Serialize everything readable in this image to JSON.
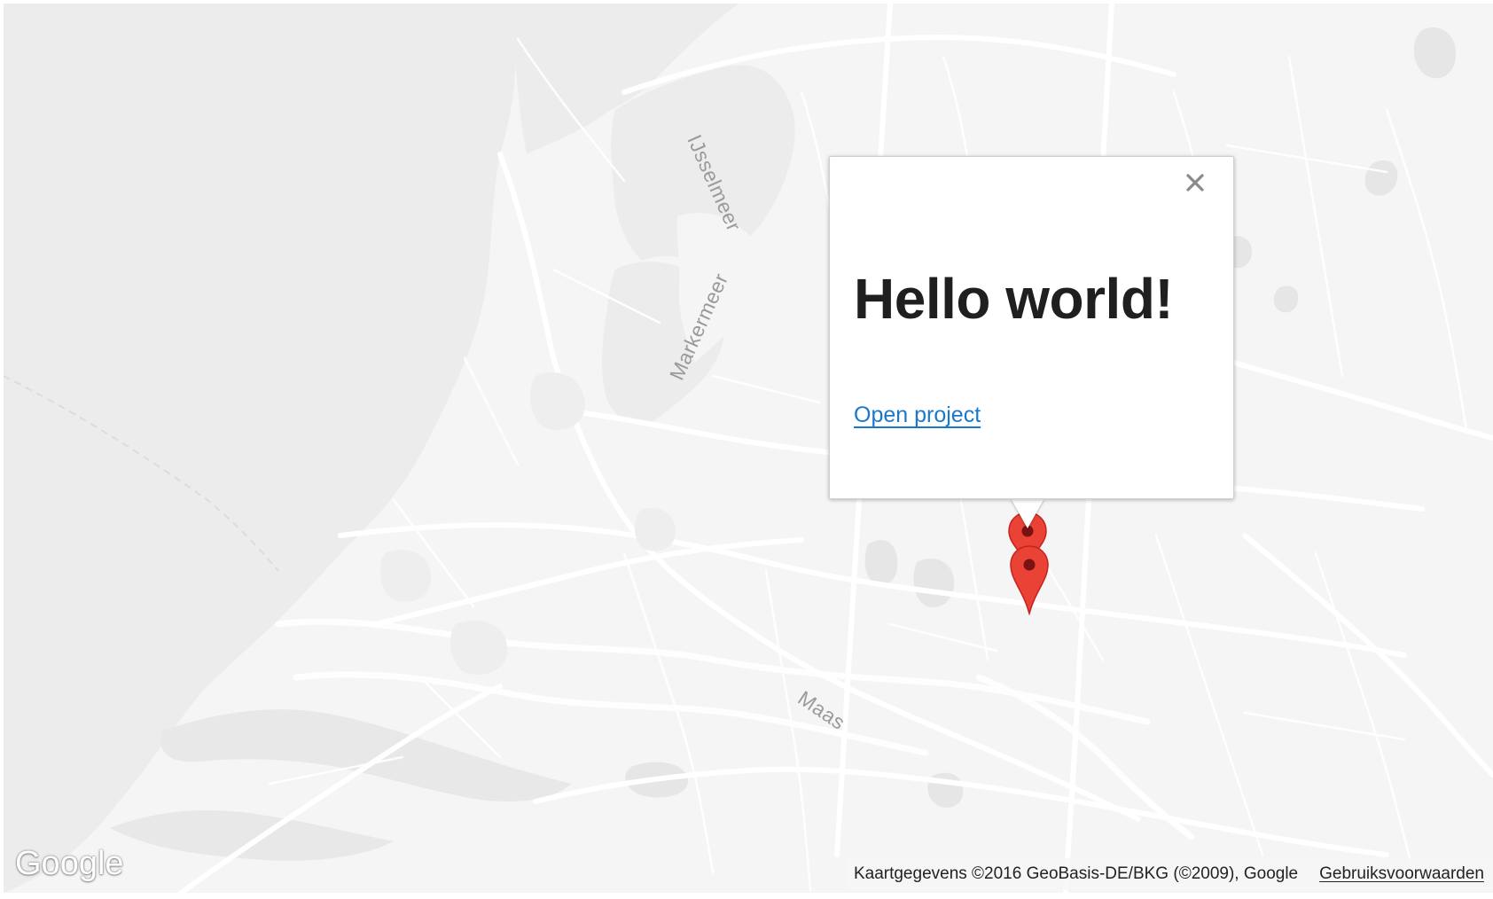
{
  "map": {
    "water_labels": [
      "IJsselmeer",
      "Markermeer",
      "Maas"
    ],
    "colors": {
      "land": "#f5f5f5",
      "water": "#ececec",
      "road": "#ffffff",
      "feature": "#e6e6e6"
    }
  },
  "info_window": {
    "title": "Hello world!",
    "link_label": "Open project",
    "close_icon": "close-icon",
    "link_color": "#1a78c9"
  },
  "markers": [
    {
      "icon": "map-pin-icon",
      "color": "#ea4335"
    },
    {
      "icon": "map-pin-icon",
      "color": "#ea4335"
    }
  ],
  "footer": {
    "logo_text": "Google",
    "attribution": "Kaartgegevens ©2016 GeoBasis-DE/BKG (©2009), Google",
    "terms_label": "Gebruiksvoorwaarden"
  }
}
